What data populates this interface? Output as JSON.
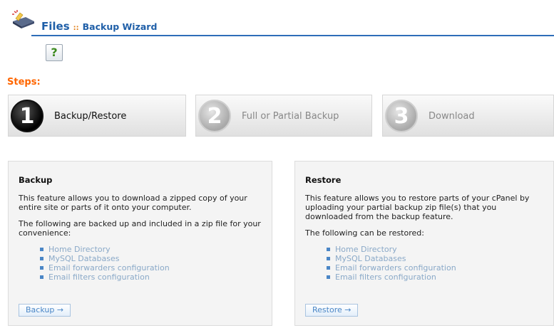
{
  "header": {
    "section": "Files",
    "separator": "::",
    "page": "Backup Wizard",
    "help_label": "?"
  },
  "steps": {
    "title": "Steps:",
    "items": [
      {
        "number": "1",
        "label": "Backup/Restore",
        "active": true
      },
      {
        "number": "2",
        "label": "Full or Partial Backup",
        "active": false
      },
      {
        "number": "3",
        "label": "Download",
        "active": false
      }
    ]
  },
  "backup": {
    "title": "Backup",
    "description": "This feature allows you to download a zipped copy of your entire site or parts of it onto your computer.",
    "list_intro": "The following are backed up and included in a zip file for your convenience:",
    "items": [
      "Home Directory",
      "MySQL Databases",
      "Email forwarders configuration",
      "Email filters configuration"
    ],
    "button": "Backup →"
  },
  "restore": {
    "title": "Restore",
    "description": "This feature allows you to restore parts of your cPanel by uploading your partial backup zip file(s) that you downloaded from the backup feature.",
    "list_intro": "The following can be restored:",
    "items": [
      "Home Directory",
      "MySQL Databases",
      "Email forwarders configuration",
      "Email filters configuration"
    ],
    "button": "Restore →"
  },
  "colors": {
    "accent": "#1f5fa8",
    "steps_title": "#ff6600",
    "link": "#8aa9c8"
  }
}
